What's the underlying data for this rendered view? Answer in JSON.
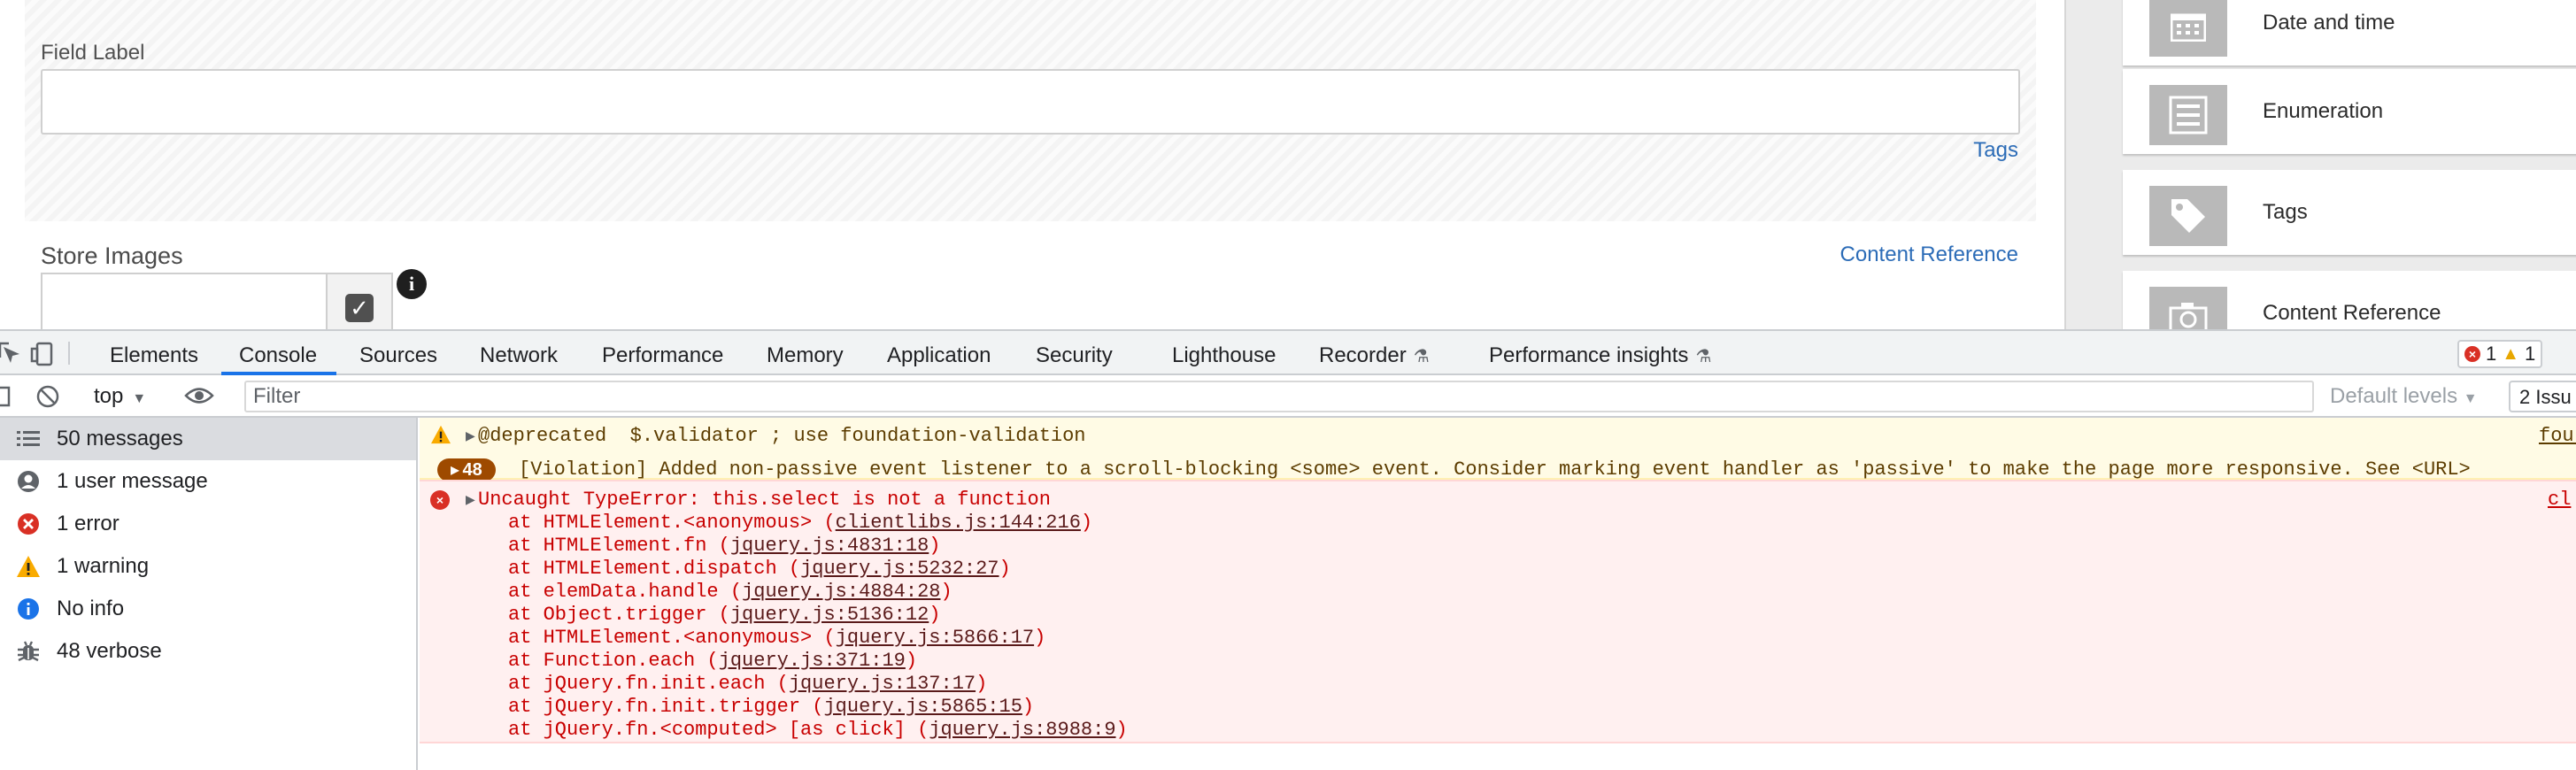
{
  "editor": {
    "field_label": "Field Label",
    "tags_link": "Tags",
    "store_images": "Store Images",
    "content_reference_link": "Content Reference"
  },
  "components": [
    {
      "label": "Date and time",
      "icon": "calendar-icon"
    },
    {
      "label": "Enumeration",
      "icon": "list-icon"
    },
    {
      "label": "Tags",
      "icon": "tag-icon"
    },
    {
      "label": "Content Reference",
      "icon": "camera-icon"
    }
  ],
  "devtools": {
    "tabs": [
      "Elements",
      "Console",
      "Sources",
      "Network",
      "Performance",
      "Memory",
      "Application",
      "Security",
      "Lighthouse",
      "Recorder",
      "Performance insights"
    ],
    "active_tab": "Console",
    "error_count": "1",
    "warning_count": "1",
    "context": "top",
    "filter_placeholder": "Filter",
    "levels": "Default levels",
    "issues": "2 Issu"
  },
  "sidebar": [
    {
      "label": "50 messages",
      "icon": "list-icon"
    },
    {
      "label": "1 user message",
      "icon": "user-icon"
    },
    {
      "label": "1 error",
      "icon": "error-icon"
    },
    {
      "label": "1 warning",
      "icon": "warning-icon"
    },
    {
      "label": "No info",
      "icon": "info-icon"
    },
    {
      "label": "48 verbose",
      "icon": "bug-icon"
    }
  ],
  "console": {
    "warning_text": "@deprecated  $.validator ; use foundation-validation",
    "warning_source": "four",
    "violation_count": "48",
    "violation_text": "[Violation] Added non-passive event listener to a scroll-blocking <some> event. Consider marking event handler as 'passive' to make the page more responsive. See <URL>",
    "error_text": "Uncaught TypeError: this.select is not a function",
    "error_source": "cl",
    "stack": [
      {
        "fn": "at HTMLElement.<anonymous> (",
        "loc": "clientlibs.js:144:216"
      },
      {
        "fn": "at HTMLElement.fn (",
        "loc": "jquery.js:4831:18"
      },
      {
        "fn": "at HTMLElement.dispatch (",
        "loc": "jquery.js:5232:27"
      },
      {
        "fn": "at elemData.handle (",
        "loc": "jquery.js:4884:28"
      },
      {
        "fn": "at Object.trigger (",
        "loc": "jquery.js:5136:12"
      },
      {
        "fn": "at HTMLElement.<anonymous> (",
        "loc": "jquery.js:5866:17"
      },
      {
        "fn": "at Function.each (",
        "loc": "jquery.js:371:19"
      },
      {
        "fn": "at jQuery.fn.init.each (",
        "loc": "jquery.js:137:17"
      },
      {
        "fn": "at jQuery.fn.init.trigger (",
        "loc": "jquery.js:5865:15"
      },
      {
        "fn": "at jQuery.fn.<computed> [as click] (",
        "loc": "jquery.js:8988:9"
      }
    ]
  }
}
